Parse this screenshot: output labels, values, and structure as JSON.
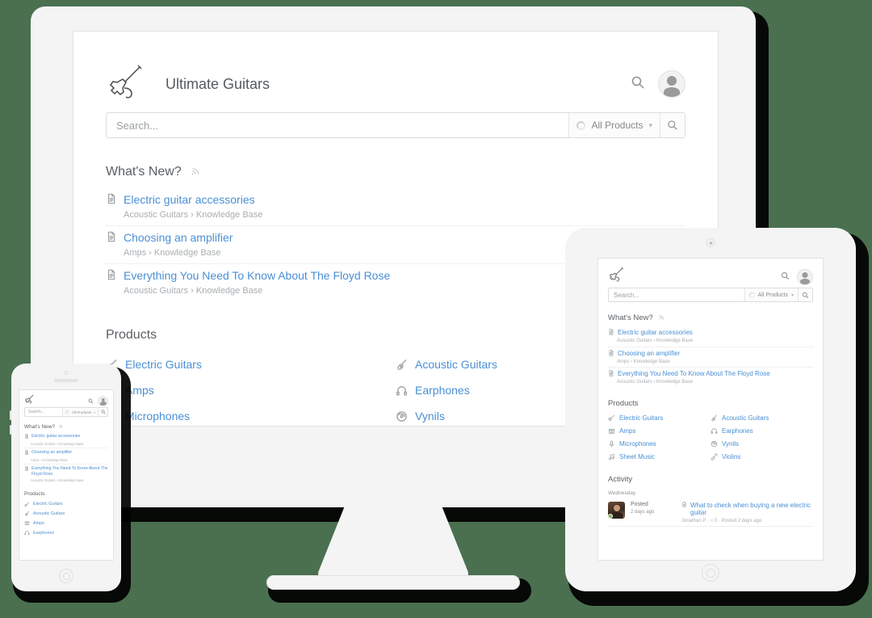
{
  "background_color": "#4a7050",
  "accent_link_color": "#4a8fd4",
  "site": {
    "brand_title": "Ultimate Guitars",
    "logo_icon": "electric-guitar-icon",
    "header_search_icon": "search-icon",
    "avatar_icon": "user-avatar-icon"
  },
  "search": {
    "placeholder": "Search...",
    "value": "",
    "scope_label": "All Products",
    "scope_icon": "product-circle-icon",
    "caret_icon": "chevron-down-icon",
    "submit_icon": "search-icon"
  },
  "whats_new": {
    "heading": "What's New?",
    "rss_icon": "rss-feed-icon",
    "items": [
      {
        "icon": "document-icon",
        "title": "Electric guitar accessories",
        "breadcrumb": "Acoustic Guitars › Knowledge Base"
      },
      {
        "icon": "document-icon",
        "title": "Choosing an amplifier",
        "breadcrumb": "Amps › Knowledge Base"
      },
      {
        "icon": "document-icon",
        "title": "Everything You Need To Know About The Floyd Rose",
        "breadcrumb": "Acoustic Guitars › Knowledge Base"
      }
    ]
  },
  "products": {
    "heading": "Products",
    "desktop_items": [
      {
        "icon": "electric-guitar-icon",
        "label": "Electric Guitars"
      },
      {
        "icon": "acoustic-guitar-icon",
        "label": "Acoustic Guitars"
      },
      {
        "icon": "amp-icon",
        "label": "Amps"
      },
      {
        "icon": "earphones-icon",
        "label": "Earphones"
      },
      {
        "icon": "microphone-icon",
        "label": "Microphones"
      },
      {
        "icon": "vinyl-icon",
        "label": "Vynils"
      }
    ],
    "tablet_items": [
      {
        "icon": "electric-guitar-icon",
        "label": "Electric Guitars"
      },
      {
        "icon": "acoustic-guitar-icon",
        "label": "Acoustic Guitars"
      },
      {
        "icon": "amp-icon",
        "label": "Amps"
      },
      {
        "icon": "earphones-icon",
        "label": "Earphones"
      },
      {
        "icon": "microphone-icon",
        "label": "Microphones"
      },
      {
        "icon": "vinyl-icon",
        "label": "Vynils"
      },
      {
        "icon": "sheet-music-icon",
        "label": "Sheet Music"
      },
      {
        "icon": "violin-icon",
        "label": "Violins"
      }
    ],
    "phone_items": [
      {
        "icon": "electric-guitar-icon",
        "label": "Electric Guitars"
      },
      {
        "icon": "acoustic-guitar-icon",
        "label": "Acoustic Guitars"
      },
      {
        "icon": "amp-icon",
        "label": "Amps"
      },
      {
        "icon": "earphones-icon",
        "label": "Earphones"
      }
    ]
  },
  "activity": {
    "heading": "Activity",
    "day_label": "Wednesday",
    "rows": [
      {
        "action": "Posted",
        "time_ago": "2 days ago",
        "doc_icon": "document-icon",
        "title": "What to check when buying a new electric guitar",
        "meta": "Jonathan P · ○ 0 · Posted 2 days ago",
        "avatar_icon": "user-photo-avatar",
        "status_icon": "online-status-icon"
      }
    ]
  },
  "devices": {
    "monitor": {
      "name": "desktop-monitor",
      "stand": "monitor-stand",
      "base": "monitor-base"
    },
    "tablet": {
      "name": "tablet-device",
      "camera_icon": "camera-icon",
      "home_button_icon": "home-button-icon"
    },
    "phone": {
      "name": "phone-device",
      "camera_icon": "camera-icon",
      "speaker_icon": "speaker-grille-icon",
      "home_button_icon": "home-button-icon"
    }
  }
}
